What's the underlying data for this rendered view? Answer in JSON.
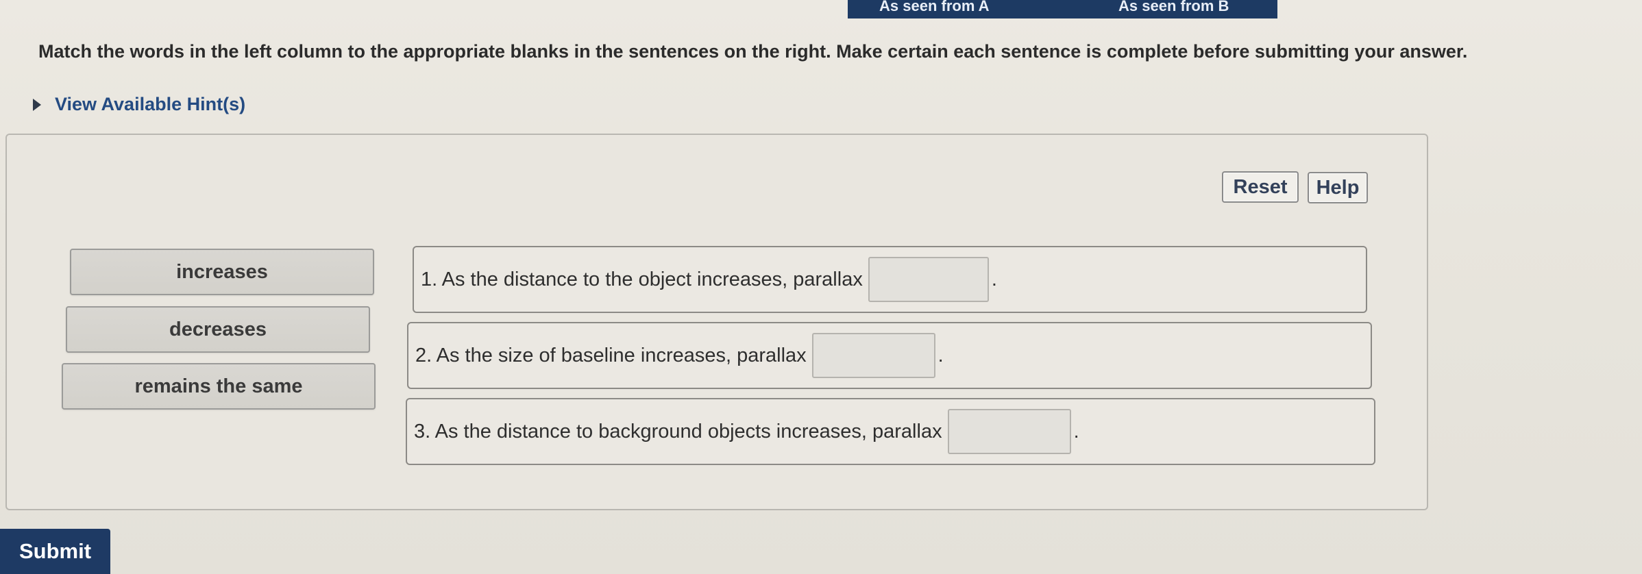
{
  "tabs": {
    "tab_a": "As seen from A",
    "tab_b": "As seen from B"
  },
  "instructions": "Match the words in the left column to the appropriate blanks in the sentences on the right. Make certain each sentence is complete before submitting your answer.",
  "hint_label": "View Available Hint(s)",
  "toolbar": {
    "reset_label": "Reset",
    "help_label": "Help"
  },
  "words": [
    {
      "label": "increases"
    },
    {
      "label": "decreases"
    },
    {
      "label": "remains the same"
    }
  ],
  "sentences": [
    {
      "text": "1. As the distance to the object increases, parallax",
      "blank_value": "",
      "end": "."
    },
    {
      "text": "2. As the size of baseline increases, parallax",
      "blank_value": "",
      "end": "."
    },
    {
      "text": "3. As the distance to background objects increases, parallax",
      "blank_value": "",
      "end": "."
    }
  ],
  "submit_label": "Submit",
  "colors": {
    "accent": "#1e3a64",
    "link": "#244b82",
    "background": "#e9e6df"
  },
  "icons": {
    "hint_toggle": "triangle-right-icon"
  }
}
